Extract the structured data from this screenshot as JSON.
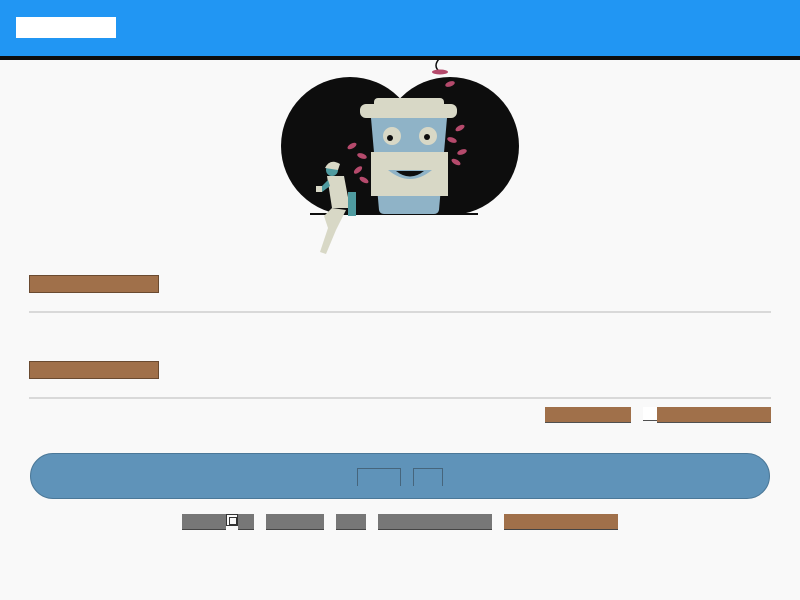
{
  "header": {
    "logo_text": "",
    "bar_color": "#2196f3"
  },
  "illustration": {
    "icon": "coffee-cup-mascot-illustration",
    "colors": [
      "#0d0d0d",
      "#d8d8c6",
      "#8fb3c7",
      "#b54a6c",
      "#4f9ba0"
    ]
  },
  "form": {
    "username_label": "",
    "username_value": "",
    "password_label": "",
    "password_value": "",
    "forgot_link": "",
    "remember_label": "",
    "submit_label": "",
    "submit_color": "#5f93b9",
    "label_color": "#a0704a"
  },
  "footer": {
    "language": "",
    "links": [
      "",
      "",
      "",
      ""
    ]
  }
}
